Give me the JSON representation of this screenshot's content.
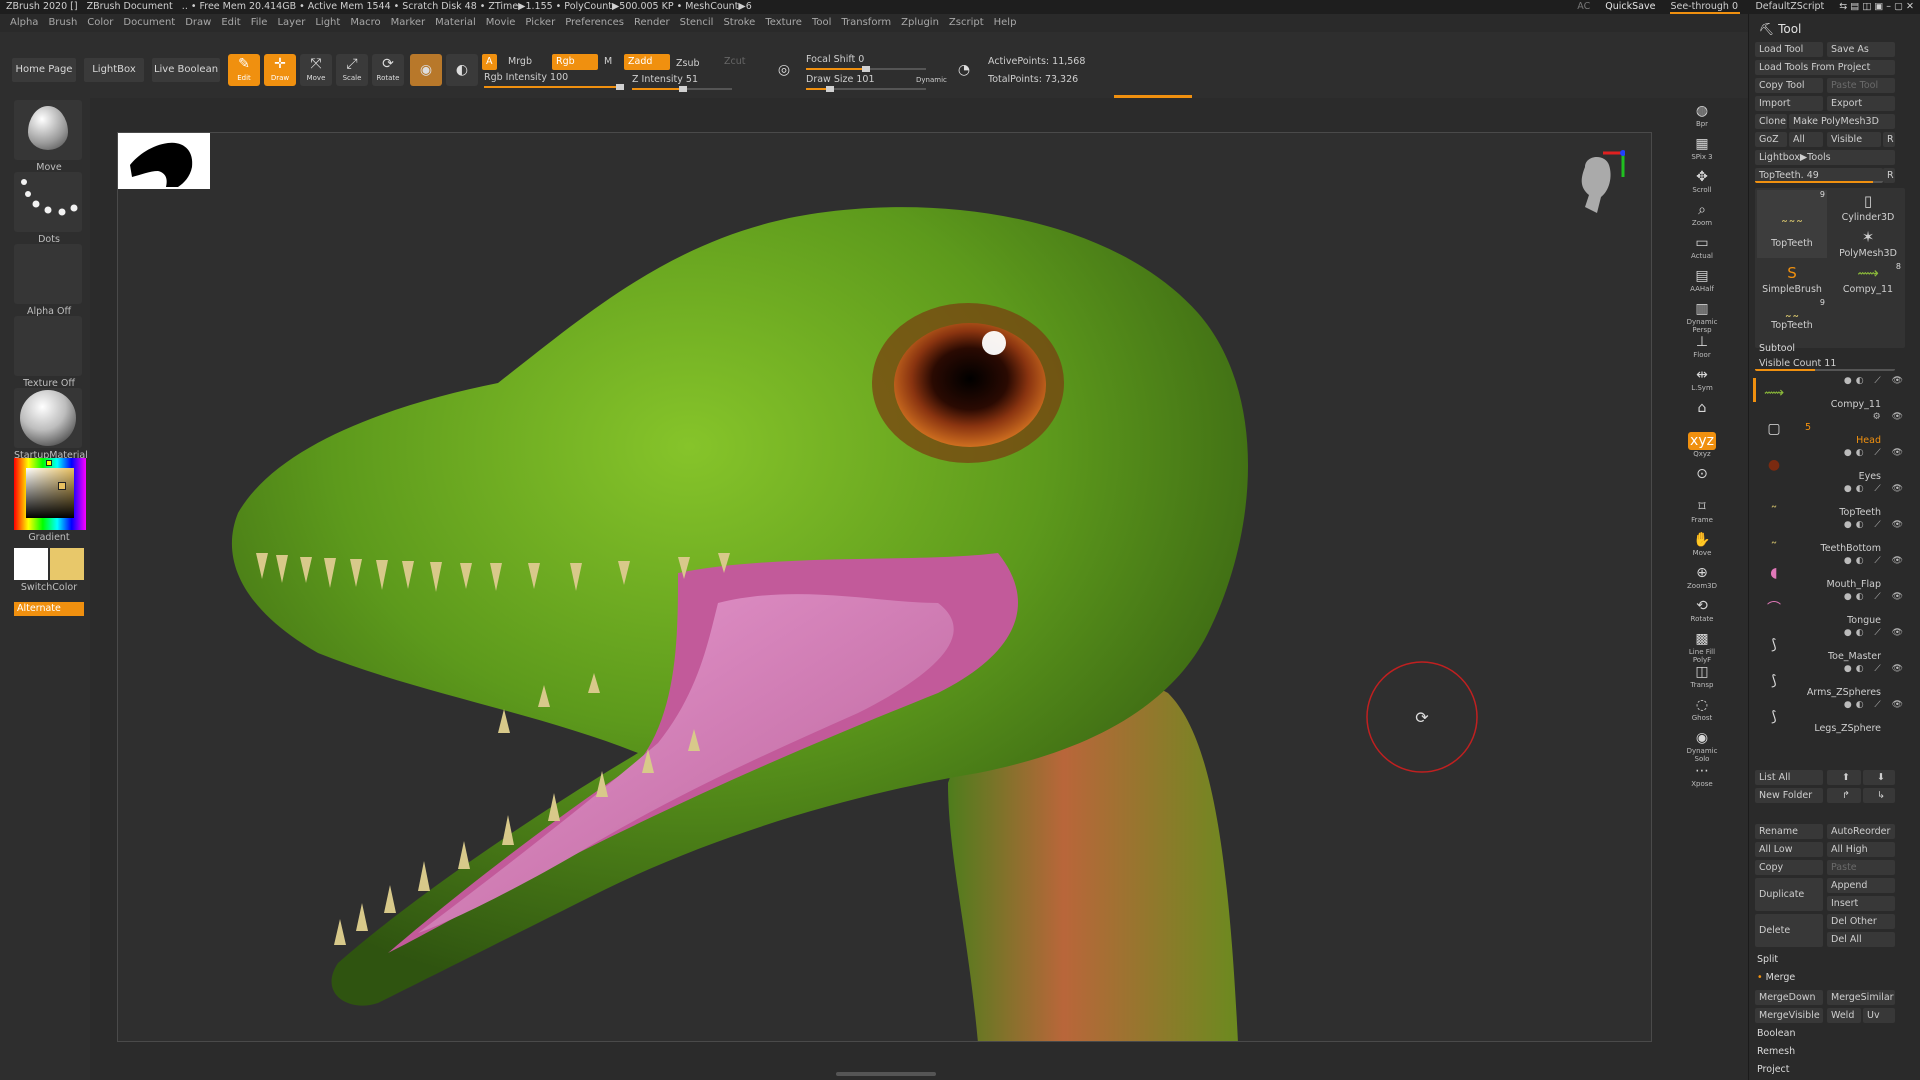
{
  "titlebar": {
    "app": "ZBrush 2020 []",
    "doc": "ZBrush Document",
    "stats": ".. • Free Mem 20.414GB • Active Mem 1544 • Scratch Disk 48 • ZTime▶1.155 • PolyCount▶500.005 KP • MeshCount▶6",
    "ac": "AC",
    "quicksave": "QuickSave",
    "see_through": "See-through  0",
    "script": "DefaultZScript"
  },
  "menu": [
    "Alpha",
    "Brush",
    "Color",
    "Document",
    "Draw",
    "Edit",
    "File",
    "Layer",
    "Light",
    "Macro",
    "Marker",
    "Material",
    "Movie",
    "Picker",
    "Preferences",
    "Render",
    "Stencil",
    "Stroke",
    "Texture",
    "Tool",
    "Transform",
    "Zplugin",
    "Zscript",
    "Help"
  ],
  "shelf": {
    "home": "Home Page",
    "lightbox": "LightBox",
    "live_boolean": "Live Boolean",
    "edit": "Edit",
    "draw": "Draw",
    "move": "Move",
    "scale": "Scale",
    "rotate": "Rotate",
    "a": "A",
    "mrgb": "Mrgb",
    "rgb": "Rgb",
    "m": "M",
    "zadd": "Zadd",
    "zsub": "Zsub",
    "zcut": "Zcut",
    "rgb_intensity": "Rgb Intensity 100",
    "z_intensity": "Z Intensity 51",
    "focal_shift": "Focal Shift 0",
    "draw_size": "Draw Size 101",
    "dynamic": "Dynamic",
    "active_points": "ActivePoints: 11,568",
    "total_points": "TotalPoints: 73,326",
    "rgb_intensity_value": 100,
    "z_intensity_value": 51,
    "draw_size_value": 101
  },
  "left": {
    "move": "Move",
    "dots": "Dots",
    "alpha": "Alpha Off",
    "texture": "Texture Off",
    "material": "StartupMaterial",
    "gradient": "Gradient",
    "switch_color": "SwitchColor",
    "alternate": "Alternate"
  },
  "rstrip": [
    "Bpr",
    "SPix 3",
    "Scroll",
    "Zoom",
    "Actual",
    "AAHalf",
    "Dynamic Persp",
    "Floor",
    "L.Sym",
    "",
    "Qxyz",
    "",
    "Frame",
    "Move",
    "Zoom3D",
    "Rotate",
    "Line Fill PolyF",
    "Transp",
    "Ghost",
    "Dynamic Solo",
    "Xpose"
  ],
  "tool": {
    "title": "Tool",
    "load_tool": "Load Tool",
    "save_as": "Save As",
    "load_from_project": "Load Tools From Project",
    "copy_tool": "Copy Tool",
    "paste_tool": "Paste Tool",
    "import": "Import",
    "export": "Export",
    "clone": "Clone",
    "make_polymesh": "Make PolyMesh3D",
    "goz": "GoZ",
    "all": "All",
    "visible": "Visible",
    "r": "R",
    "lightbox_tools": "Lightbox▶Tools",
    "top_teeth": "TopTeeth. 49",
    "thumbs": [
      {
        "label": "TopTeeth",
        "badge": "9"
      },
      {
        "label": "Cylinder3D",
        "badge": ""
      },
      {
        "label": "PolyMesh3D",
        "badge": ""
      },
      {
        "label": "SimpleBrush",
        "badge": ""
      },
      {
        "label": "Compy_11",
        "badge": "8"
      },
      {
        "label": "TopTeeth",
        "badge": "9"
      }
    ],
    "subtool": "Subtool",
    "visible_count": "Visible Count 11",
    "folder_count": "5",
    "subtools": [
      "Compy_11",
      "Head",
      "Eyes",
      "TopTeeth",
      "TeethBottom",
      "Mouth_Flap",
      "Tongue",
      "Toe_Master",
      "Arms_ZSpheres",
      "Legs_ZSphere"
    ],
    "list_all": "List All",
    "new_folder": "New Folder",
    "rename": "Rename",
    "auto_reorder": "AutoReorder",
    "all_low": "All Low",
    "all_high": "All High",
    "copy": "Copy",
    "paste": "Paste",
    "duplicate": "Duplicate",
    "append": "Append",
    "insert": "Insert",
    "delete": "Delete",
    "del_other": "Del Other",
    "del_all": "Del All",
    "split": "Split",
    "merge": "Merge",
    "merge_down": "MergeDown",
    "merge_similar": "MergeSimilar",
    "merge_visible": "MergeVisible",
    "weld": "Weld",
    "uv": "Uv",
    "boolean": "Boolean",
    "remesh": "Remesh",
    "project": "Project"
  },
  "colors": {
    "accent": "#f0900f",
    "model_green": "#5d9a1c",
    "tongue": "#d97cb8"
  }
}
